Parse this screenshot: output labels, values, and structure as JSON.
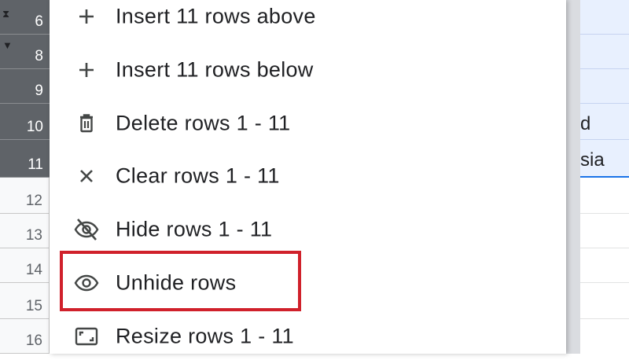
{
  "row_headers": [
    {
      "label": "6",
      "state": "selected",
      "marker": "hidden-rows-marker"
    },
    {
      "label": "8",
      "state": "selected",
      "marker": "hidden-rows-arrow"
    },
    {
      "label": "9",
      "state": "selected"
    },
    {
      "label": "10",
      "state": "selected"
    },
    {
      "label": "11",
      "state": "selected"
    },
    {
      "label": "12",
      "state": "unselected"
    },
    {
      "label": "13",
      "state": "unselected"
    },
    {
      "label": "14",
      "state": "unselected"
    },
    {
      "label": "15",
      "state": "unselected"
    },
    {
      "label": "16",
      "state": "unselected"
    }
  ],
  "cells": {
    "row10_text": "d",
    "row11_text": "sia"
  },
  "context_menu": {
    "items": [
      {
        "label": "Insert 11 rows above",
        "icon": "plus-icon"
      },
      {
        "label": "Insert 11 rows below",
        "icon": "plus-icon"
      },
      {
        "label": "Delete rows 1 - 11",
        "icon": "trash-icon"
      },
      {
        "label": "Clear rows 1 - 11",
        "icon": "close-icon"
      },
      {
        "label": "Hide rows 1 - 11",
        "icon": "eye-off-icon"
      },
      {
        "label": "Unhide rows",
        "icon": "eye-icon",
        "highlighted": true
      },
      {
        "label": "Resize rows 1 - 11",
        "icon": "resize-icon"
      }
    ]
  },
  "colors": {
    "selected_header": "#5f6368",
    "highlight": "#d0212b",
    "selection_band": "#e8f0fe"
  }
}
